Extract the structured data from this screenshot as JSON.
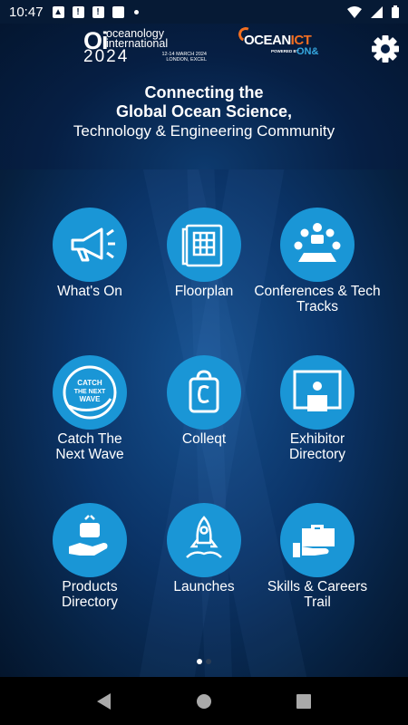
{
  "status_bar": {
    "time": "10:47",
    "notification_icons": [
      "image-icon",
      "message-icon",
      "message-icon",
      "sd-card-icon"
    ],
    "right_icons": [
      "wifi-icon",
      "signal-icon",
      "battery-icon"
    ]
  },
  "header": {
    "oi_logo": {
      "mark": "Oi",
      "line1": "oceanology",
      "line2": "international",
      "year": "2024",
      "date": "12-14 MARCH 2024",
      "location": "LONDON, EXCEL"
    },
    "oceanict_logo": {
      "ocean": "OCEAN",
      "ict": "ICT",
      "powered": "POWERED BY",
      "on": "ON&"
    },
    "settings_icon": "gear-icon",
    "tagline": {
      "line1": "Connecting the",
      "line2": "Global Ocean Science,",
      "line3": "Technology & Engineering Community"
    }
  },
  "tiles": [
    {
      "id": "whats-on",
      "label": "What's On",
      "icon": "megaphone-icon"
    },
    {
      "id": "floorplan",
      "label": "Floorplan",
      "icon": "floorplan-icon"
    },
    {
      "id": "conferences",
      "label": "Conferences & Tech Tracks",
      "icon": "conference-icon"
    },
    {
      "id": "catch-next-wave",
      "label": "Catch The Next Wave",
      "icon": "wave-logo-icon",
      "icon_text": [
        "CATCH",
        "THE NEXT",
        "WAVE"
      ]
    },
    {
      "id": "colleqt",
      "label": "Colleqt",
      "icon": "colleqt-bag-icon"
    },
    {
      "id": "exhibitor-directory",
      "label": "Exhibitor Directory",
      "icon": "presenter-screen-icon"
    },
    {
      "id": "products-directory",
      "label": "Products Directory",
      "icon": "hand-product-icon"
    },
    {
      "id": "launches",
      "label": "Launches",
      "icon": "rocket-icon"
    },
    {
      "id": "skills-careers",
      "label": "Skills & Careers Trail",
      "icon": "briefcase-hand-icon"
    }
  ],
  "pager": {
    "pages": 2,
    "current": 1
  },
  "colors": {
    "accent": "#1a96d6",
    "background": "#0b3468",
    "ict_orange": "#f36f21"
  }
}
